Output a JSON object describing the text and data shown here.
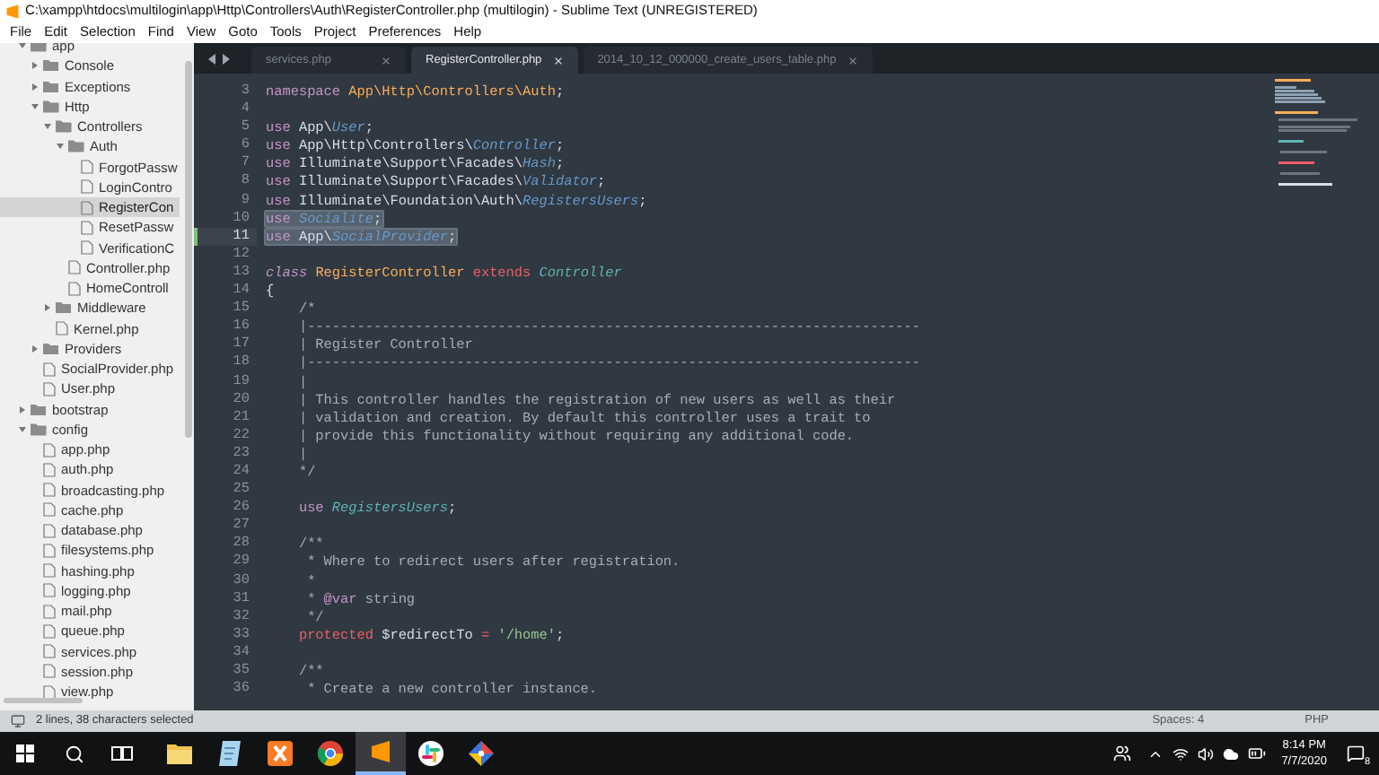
{
  "window": {
    "title": "C:\\xampp\\htdocs\\multilogin\\app\\Http\\Controllers\\Auth\\RegisterController.php (multilogin) - Sublime Text (UNREGISTERED)"
  },
  "menu": [
    "File",
    "Edit",
    "Selection",
    "Find",
    "View",
    "Goto",
    "Tools",
    "Project",
    "Preferences",
    "Help"
  ],
  "sidebar": {
    "tree": [
      {
        "kind": "folder",
        "label": "app",
        "expanded": true,
        "selected": false,
        "children": [
          {
            "kind": "folder",
            "label": "Console",
            "expanded": false,
            "selected": false
          },
          {
            "kind": "folder",
            "label": "Exceptions",
            "expanded": false,
            "selected": false
          },
          {
            "kind": "folder",
            "label": "Http",
            "expanded": true,
            "selected": false,
            "children": [
              {
                "kind": "folder",
                "label": "Controllers",
                "expanded": true,
                "selected": false,
                "children": [
                  {
                    "kind": "folder",
                    "label": "Auth",
                    "expanded": true,
                    "selected": false,
                    "children": [
                      {
                        "kind": "file",
                        "label": "ForgotPassw",
                        "selected": false
                      },
                      {
                        "kind": "file",
                        "label": "LoginContro",
                        "selected": false
                      },
                      {
                        "kind": "file",
                        "label": "RegisterCon",
                        "selected": true
                      },
                      {
                        "kind": "file",
                        "label": "ResetPassw",
                        "selected": false
                      },
                      {
                        "kind": "file",
                        "label": "VerificationC",
                        "selected": false
                      }
                    ]
                  },
                  {
                    "kind": "file",
                    "label": "Controller.php",
                    "selected": false
                  },
                  {
                    "kind": "file",
                    "label": "HomeControll",
                    "selected": false
                  }
                ]
              },
              {
                "kind": "folder",
                "label": "Middleware",
                "expanded": false,
                "selected": false
              },
              {
                "kind": "file",
                "label": "Kernel.php",
                "selected": false
              }
            ]
          },
          {
            "kind": "folder",
            "label": "Providers",
            "expanded": false,
            "selected": false
          },
          {
            "kind": "file",
            "label": "SocialProvider.php",
            "selected": false
          },
          {
            "kind": "file",
            "label": "User.php",
            "selected": false
          }
        ]
      },
      {
        "kind": "folder",
        "label": "bootstrap",
        "expanded": false,
        "selected": false
      },
      {
        "kind": "folder",
        "label": "config",
        "expanded": true,
        "selected": false,
        "children": [
          {
            "kind": "file",
            "label": "app.php",
            "selected": false
          },
          {
            "kind": "file",
            "label": "auth.php",
            "selected": false
          },
          {
            "kind": "file",
            "label": "broadcasting.php",
            "selected": false
          },
          {
            "kind": "file",
            "label": "cache.php",
            "selected": false
          },
          {
            "kind": "file",
            "label": "database.php",
            "selected": false
          },
          {
            "kind": "file",
            "label": "filesystems.php",
            "selected": false
          },
          {
            "kind": "file",
            "label": "hashing.php",
            "selected": false
          },
          {
            "kind": "file",
            "label": "logging.php",
            "selected": false
          },
          {
            "kind": "file",
            "label": "mail.php",
            "selected": false
          },
          {
            "kind": "file",
            "label": "queue.php",
            "selected": false
          },
          {
            "kind": "file",
            "label": "services.php",
            "selected": false
          },
          {
            "kind": "file",
            "label": "session.php",
            "selected": false
          },
          {
            "kind": "file",
            "label": "view.php",
            "selected": false
          }
        ]
      }
    ]
  },
  "tabs": [
    {
      "label": "services.php",
      "selected": false
    },
    {
      "label": "RegisterController.php",
      "selected": true
    },
    {
      "label": "2014_10_12_000000_create_users_table.php",
      "selected": false
    }
  ],
  "editor": {
    "lines": [
      {
        "number": "3",
        "selected": false,
        "current": false,
        "tokens": [
          {
            "kind": "keyword",
            "text": "namespace "
          },
          {
            "kind": "namespace",
            "text": "App\\Http\\Controllers\\Auth"
          },
          {
            "kind": "plain",
            "text": ";"
          }
        ]
      },
      {
        "number": "4",
        "selected": false,
        "current": false
      },
      {
        "number": "5",
        "selected": false,
        "current": false,
        "tokens": [
          {
            "kind": "keyword",
            "text": "use"
          },
          {
            "kind": "plain",
            "text": " App\\"
          },
          {
            "kind": "type",
            "text": "User"
          },
          {
            "kind": "plain",
            "text": ";"
          }
        ]
      },
      {
        "number": "6",
        "selected": false,
        "current": false,
        "tokens": [
          {
            "kind": "keyword",
            "text": "use"
          },
          {
            "kind": "plain",
            "text": " App\\Http\\Controllers\\"
          },
          {
            "kind": "type",
            "text": "Controller"
          },
          {
            "kind": "plain",
            "text": ";"
          }
        ]
      },
      {
        "number": "7",
        "selected": false,
        "current": false,
        "tokens": [
          {
            "kind": "keyword",
            "text": "use"
          },
          {
            "kind": "plain",
            "text": " Illuminate\\Support\\Facades\\"
          },
          {
            "kind": "type",
            "text": "Hash"
          },
          {
            "kind": "plain",
            "text": ";"
          }
        ]
      },
      {
        "number": "8",
        "selected": false,
        "current": false,
        "tokens": [
          {
            "kind": "keyword",
            "text": "use"
          },
          {
            "kind": "plain",
            "text": " Illuminate\\Support\\Facades\\"
          },
          {
            "kind": "type",
            "text": "Validator"
          },
          {
            "kind": "plain",
            "text": ";"
          }
        ]
      },
      {
        "number": "9",
        "selected": false,
        "current": false,
        "tokens": [
          {
            "kind": "keyword",
            "text": "use"
          },
          {
            "kind": "plain",
            "text": " Illuminate\\Foundation\\Auth\\"
          },
          {
            "kind": "type",
            "text": "RegistersUsers"
          },
          {
            "kind": "plain",
            "text": ";"
          }
        ]
      },
      {
        "number": "10",
        "selected": true,
        "current": false,
        "tokens": [
          {
            "kind": "keyword",
            "text": "use "
          },
          {
            "kind": "type",
            "text": "Socialite"
          },
          {
            "kind": "plain",
            "text": ";"
          }
        ]
      },
      {
        "number": "11",
        "selected": true,
        "current": true,
        "tokens": [
          {
            "kind": "keyword",
            "text": "use"
          },
          {
            "kind": "plain",
            "text": " App\\"
          },
          {
            "kind": "type",
            "text": "SocialProvider"
          },
          {
            "kind": "plain",
            "text": ";"
          }
        ]
      },
      {
        "number": "12",
        "selected": false,
        "current": false
      },
      {
        "number": "13",
        "selected": false,
        "current": false,
        "tokens": [
          {
            "kind": "storage",
            "text": "class "
          },
          {
            "kind": "classname",
            "text": "RegisterController "
          },
          {
            "kind": "modifier",
            "text": "extends "
          },
          {
            "kind": "inherited",
            "text": "Controller"
          }
        ]
      },
      {
        "number": "14",
        "selected": false,
        "current": false,
        "tokens": [
          {
            "kind": "plain",
            "text": "{"
          }
        ]
      },
      {
        "number": "15",
        "selected": false,
        "current": false,
        "tokens": [
          {
            "kind": "comment",
            "text": "    /*"
          }
        ]
      },
      {
        "number": "16",
        "selected": false,
        "current": false,
        "tokens": [
          {
            "kind": "comment",
            "text": "    |--------------------------------------------------------------------------"
          }
        ]
      },
      {
        "number": "17",
        "selected": false,
        "current": false,
        "tokens": [
          {
            "kind": "comment",
            "text": "    | Register Controller"
          }
        ]
      },
      {
        "number": "18",
        "selected": false,
        "current": false,
        "tokens": [
          {
            "kind": "comment",
            "text": "    |--------------------------------------------------------------------------"
          }
        ]
      },
      {
        "number": "19",
        "selected": false,
        "current": false,
        "tokens": [
          {
            "kind": "comment",
            "text": "    |"
          }
        ]
      },
      {
        "number": "20",
        "selected": false,
        "current": false,
        "tokens": [
          {
            "kind": "comment",
            "text": "    | This controller handles the registration of new users as well as their"
          }
        ]
      },
      {
        "number": "21",
        "selected": false,
        "current": false,
        "tokens": [
          {
            "kind": "comment",
            "text": "    | validation and creation. By default this controller uses a trait to"
          }
        ]
      },
      {
        "number": "22",
        "selected": false,
        "current": false,
        "tokens": [
          {
            "kind": "comment",
            "text": "    | provide this functionality without requiring any additional code."
          }
        ]
      },
      {
        "number": "23",
        "selected": false,
        "current": false,
        "tokens": [
          {
            "kind": "comment",
            "text": "    |"
          }
        ]
      },
      {
        "number": "24",
        "selected": false,
        "current": false,
        "tokens": [
          {
            "kind": "comment",
            "text": "    */"
          }
        ]
      },
      {
        "number": "25",
        "selected": false,
        "current": false
      },
      {
        "number": "26",
        "selected": false,
        "current": false,
        "tokens": [
          {
            "kind": "keyword",
            "text": "    use "
          },
          {
            "kind": "inherited",
            "text": "RegistersUsers"
          },
          {
            "kind": "plain",
            "text": ";"
          }
        ]
      },
      {
        "number": "27",
        "selected": false,
        "current": false
      },
      {
        "number": "28",
        "selected": false,
        "current": false,
        "tokens": [
          {
            "kind": "comment",
            "text": "    /**"
          }
        ]
      },
      {
        "number": "29",
        "selected": false,
        "current": false,
        "tokens": [
          {
            "kind": "comment",
            "text": "     * Where to redirect users after registration."
          }
        ]
      },
      {
        "number": "30",
        "selected": false,
        "current": false,
        "tokens": [
          {
            "kind": "comment",
            "text": "     *"
          }
        ]
      },
      {
        "number": "31",
        "selected": false,
        "current": false,
        "tokens": [
          {
            "kind": "comment",
            "text": "     * "
          },
          {
            "kind": "doctag",
            "text": "@var"
          },
          {
            "kind": "comment",
            "text": " string"
          }
        ]
      },
      {
        "number": "32",
        "selected": false,
        "current": false,
        "tokens": [
          {
            "kind": "comment",
            "text": "     */"
          }
        ]
      },
      {
        "number": "33",
        "selected": false,
        "current": false,
        "tokens": [
          {
            "kind": "modifier",
            "text": "    protected"
          },
          {
            "kind": "plain",
            "text": " $redirectTo "
          },
          {
            "kind": "modifier",
            "text": "= "
          },
          {
            "kind": "string",
            "text": "'/home'"
          },
          {
            "kind": "plain",
            "text": ";"
          }
        ]
      },
      {
        "number": "34",
        "selected": false,
        "current": false
      },
      {
        "number": "35",
        "selected": false,
        "current": false,
        "tokens": [
          {
            "kind": "comment",
            "text": "    /**"
          }
        ]
      },
      {
        "number": "36",
        "selected": false,
        "current": false,
        "tokens": [
          {
            "kind": "comment",
            "text": "     * Create a new controller instance."
          }
        ]
      }
    ]
  },
  "status_bar": {
    "selection": "2 lines, 38 characters selected",
    "indentation": "Spaces: 4",
    "syntax": "PHP"
  },
  "taskbar": {
    "apps": [
      {
        "kind": "explorer",
        "selected": false
      },
      {
        "kind": "notepad",
        "selected": false
      },
      {
        "kind": "xampp",
        "selected": false
      },
      {
        "kind": "chrome",
        "selected": false
      },
      {
        "kind": "sublime",
        "selected": true
      },
      {
        "kind": "slack",
        "selected": false
      },
      {
        "kind": "git",
        "selected": false
      }
    ],
    "time": "8:14 PM",
    "date": "7/7/2020",
    "notifications": "8"
  }
}
